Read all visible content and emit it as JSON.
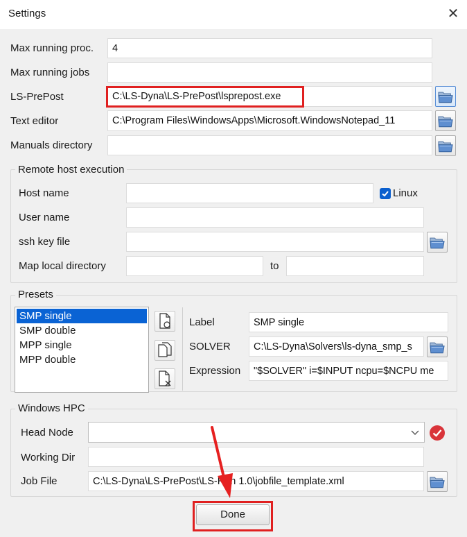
{
  "window": {
    "title": "Settings",
    "close_glyph": "✕"
  },
  "general": {
    "max_running_proc": {
      "label": "Max running proc.",
      "value": "4"
    },
    "max_running_jobs": {
      "label": "Max running jobs",
      "value": ""
    },
    "ls_prepost": {
      "label": "LS-PrePost",
      "value": "C:\\LS-Dyna\\LS-PrePost\\lsprepost.exe"
    },
    "text_editor": {
      "label": "Text editor",
      "value": "C:\\Program Files\\WindowsApps\\Microsoft.WindowsNotepad_11"
    },
    "manuals_directory": {
      "label": "Manuals directory",
      "value": ""
    }
  },
  "remote": {
    "title": "Remote host execution",
    "host_name": {
      "label": "Host name",
      "value": ""
    },
    "linux": {
      "label": "Linux",
      "checked": true
    },
    "user_name": {
      "label": "User name",
      "value": ""
    },
    "ssh_key_file": {
      "label": "ssh key file",
      "value": ""
    },
    "map_local_directory": {
      "label": "Map local directory",
      "value": "",
      "to_label": "to",
      "to_value": ""
    }
  },
  "presets": {
    "title": "Presets",
    "items": [
      "SMP single",
      "SMP double",
      "MPP single",
      "MPP double"
    ],
    "selected": "SMP single",
    "label": {
      "label": "Label",
      "value": "SMP single"
    },
    "solver": {
      "label": "SOLVER",
      "value": "C:\\LS-Dyna\\Solvers\\ls-dyna_smp_s"
    },
    "expression": {
      "label": "Expression",
      "value": "\"$SOLVER\" i=$INPUT ncpu=$NCPU me"
    }
  },
  "hpc": {
    "title": "Windows HPC",
    "head_node": {
      "label": "Head Node",
      "value": ""
    },
    "working_dir": {
      "label": "Working Dir",
      "value": ""
    },
    "job_file": {
      "label": "Job File",
      "value": "C:\\LS-Dyna\\LS-PrePost\\LS-Run 1.0\\jobfile_template.xml"
    }
  },
  "done_label": "Done",
  "colors": {
    "highlight_red": "#e02020",
    "selection_blue": "#0a63d4",
    "status_red": "#d9343a"
  },
  "icons": [
    "close-icon",
    "folder-open-icon",
    "new-document-icon",
    "copy-document-icon",
    "delete-document-icon",
    "checkmark-icon",
    "chevron-down-icon",
    "check-circle-icon"
  ]
}
